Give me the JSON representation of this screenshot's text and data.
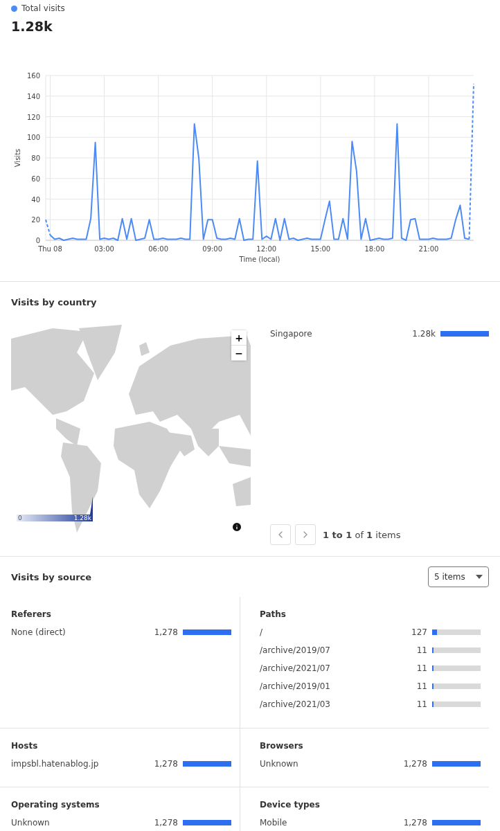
{
  "summary": {
    "value": "1.28k"
  },
  "chart": {
    "chart_data": {
      "type": "line",
      "grid": true,
      "xlabel": "Time (local)",
      "ylabel": "Visits",
      "xlim": [
        -0.25,
        23.5
      ],
      "ylim": [
        0,
        160
      ],
      "xticks": [
        {
          "value": 0,
          "label": "Thu 08"
        },
        {
          "value": 3,
          "label": "03:00"
        },
        {
          "value": 6,
          "label": "06:00"
        },
        {
          "value": 9,
          "label": "09:00"
        },
        {
          "value": 12,
          "label": "12:00"
        },
        {
          "value": 15,
          "label": "15:00"
        },
        {
          "value": 18,
          "label": "18:00"
        },
        {
          "value": 21,
          "label": "21:00"
        }
      ],
      "yticks": [
        0,
        20,
        40,
        60,
        80,
        100,
        120,
        140,
        160
      ],
      "x": [
        -0.25,
        0,
        0.25,
        0.5,
        0.75,
        1,
        1.25,
        1.5,
        1.75,
        2,
        2.25,
        2.5,
        2.75,
        3,
        3.25,
        3.5,
        3.75,
        4,
        4.25,
        4.5,
        4.75,
        5,
        5.25,
        5.5,
        5.75,
        6,
        6.25,
        6.5,
        6.75,
        7,
        7.25,
        7.5,
        7.75,
        8,
        8.25,
        8.5,
        8.75,
        9,
        9.25,
        9.5,
        9.75,
        10,
        10.25,
        10.5,
        10.75,
        11,
        11.25,
        11.5,
        11.75,
        12,
        12.25,
        12.5,
        12.75,
        13,
        13.25,
        13.5,
        13.75,
        14,
        14.25,
        14.5,
        14.75,
        15,
        15.25,
        15.5,
        15.75,
        16,
        16.25,
        16.5,
        16.75,
        17,
        17.25,
        17.5,
        17.75,
        18,
        18.25,
        18.5,
        18.75,
        19,
        19.25,
        19.5,
        19.75,
        20,
        20.25,
        20.5,
        20.75,
        21,
        21.25,
        21.5,
        21.75,
        22,
        22.25,
        22.5,
        22.75,
        23,
        23.25,
        23.5
      ],
      "series": [
        {
          "name": "Total visits",
          "color": "#4c8bf5",
          "values": [
            20,
            5,
            1,
            2,
            0,
            1,
            2,
            1,
            1,
            1,
            21,
            95,
            1,
            2,
            1,
            2,
            0,
            21,
            1,
            21,
            0,
            1,
            2,
            20,
            1,
            1,
            2,
            1,
            1,
            1,
            2,
            1,
            1,
            113,
            79,
            1,
            20,
            20,
            2,
            1,
            1,
            2,
            1,
            21,
            0,
            1,
            1,
            77,
            1,
            4,
            1,
            21,
            0,
            21,
            1,
            2,
            0,
            1,
            2,
            1,
            1,
            1,
            20,
            38,
            1,
            1,
            21,
            1,
            96,
            67,
            1,
            21,
            0,
            1,
            2,
            1,
            1,
            2,
            113,
            2,
            0,
            20,
            21,
            1,
            1,
            1,
            2,
            1,
            1,
            1,
            2,
            20,
            34,
            2,
            1,
            152
          ]
        }
      ]
    }
  },
  "country_section": {
    "title": "Visits by country",
    "map": {
      "kind": "picture",
      "zoom_in": "+",
      "zoom_out": "−",
      "legend_min": "0",
      "legend_max": "1.28k"
    },
    "countries": [
      {
        "name": "Singapore",
        "count": "1.28k",
        "level": 1
      }
    ],
    "pagination": {
      "summary": "**1 to 1** of **1** items"
    }
  },
  "source_section": {
    "title": "Visits by source",
    "items_select": "5 items",
    "groups": [
      {
        "title": "Referers",
        "rows": [
          {
            "label": "None (direct)",
            "count": "1,278",
            "level": 1
          }
        ]
      },
      {
        "title": "Paths",
        "rows": [
          {
            "label": "/",
            "count": "127",
            "level": 0.1
          },
          {
            "label": "/archive/2019/07",
            "count": "11",
            "level": 0.01
          },
          {
            "label": "/archive/2021/07",
            "count": "11",
            "level": 0.01
          },
          {
            "label": "/archive/2019/01",
            "count": "11",
            "level": 0.01
          },
          {
            "label": "/archive/2021/03",
            "count": "11",
            "level": 0.01
          }
        ]
      },
      {
        "title": "Hosts",
        "rows": [
          {
            "label": "impsbl.hatenablog.jp",
            "count": "1,278",
            "level": 1
          }
        ]
      },
      {
        "title": "Browsers",
        "rows": [
          {
            "label": "Unknown",
            "count": "1,278",
            "level": 1
          }
        ]
      },
      {
        "title": "Operating systems",
        "rows": [
          {
            "label": "Unknown",
            "count": "1,278",
            "level": 1
          }
        ]
      },
      {
        "title": "Device types",
        "rows": [
          {
            "label": "Mobile",
            "count": "1,278",
            "level": 1
          }
        ]
      }
    ]
  }
}
